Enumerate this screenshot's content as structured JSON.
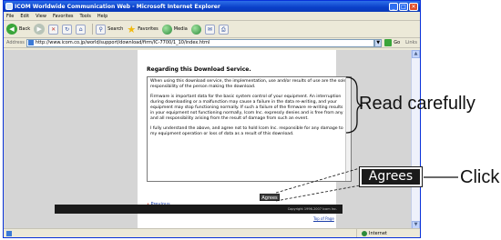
{
  "window": {
    "title": "ICOM Worldwide Communication Web - Microsoft Internet Explorer",
    "minimize": "_",
    "maximize": "□",
    "close": "✕"
  },
  "menu": [
    "File",
    "Edit",
    "View",
    "Favorites",
    "Tools",
    "Help"
  ],
  "toolbar": {
    "back": "Back",
    "search": "Search",
    "favorites": "Favorites",
    "media": "Media"
  },
  "address": {
    "label": "Address",
    "url": "http://www.icom.co.jp/world/support/download/firm/IC-7700/1_10/index.html",
    "go": "Go",
    "links": "Links"
  },
  "page": {
    "heading": "Regarding this Download Service.",
    "paragraphs": [
      "When using this download service, the implementation, use and/or results of use are the sole responsibility of the person making the download.",
      "Firmware is important data for the basic system control of your equipment. An interruption during downloading or a malfunction may cause a failure in the data re-writing, and your equipment may stop functioning normally. If such a failure of the firmware re-writing results in your equipment not functioning normally, Icom Inc. expressly denies and is free from any and all responsibility arising from the result of damage from such an event.",
      "I fully understand the above, and agree not to hold Icom Inc. responsible for any damage to my equipment operation or loss of data as a result of this download."
    ],
    "agrees_button": "Agrees",
    "previous_link": "Previous",
    "top_link": "Top of Page",
    "copyright": "Copyright 1996-2007 Icom Inc."
  },
  "status": {
    "zone": "Internet"
  },
  "annotations": {
    "read_carefully": "Read carefully",
    "agrees_large": "Agrees",
    "click": "Click"
  }
}
